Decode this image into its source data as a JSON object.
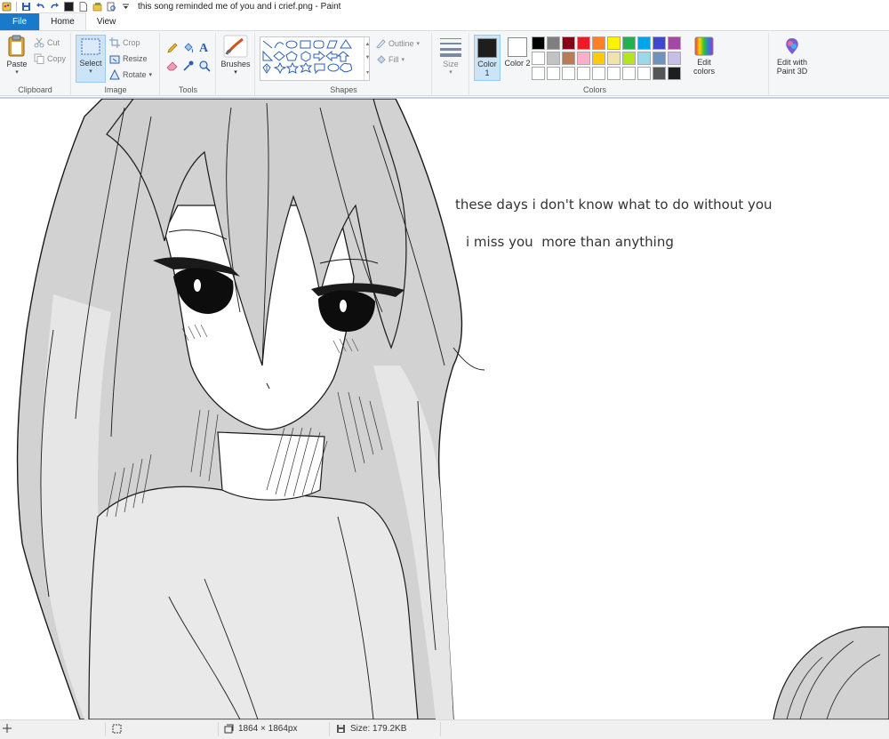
{
  "window": {
    "title": "this song reminded me of you and i crief.png - Paint"
  },
  "tabs": {
    "file": "File",
    "home": "Home",
    "view": "View"
  },
  "clipboard": {
    "paste": "Paste",
    "cut": "Cut",
    "copy": "Copy",
    "label": "Clipboard"
  },
  "image": {
    "select": "Select",
    "crop": "Crop",
    "resize": "Resize",
    "rotate": "Rotate",
    "label": "Image"
  },
  "tools": {
    "label": "Tools",
    "brushes": "Brushes"
  },
  "shapes": {
    "outline": "Outline",
    "fill": "Fill",
    "label": "Shapes"
  },
  "size": {
    "label": "Size"
  },
  "colors": {
    "color1": "Color 1",
    "color1_value": "#1e1e1e",
    "color2": "Color 2",
    "color2_value": "#ffffff",
    "edit_colors": "Edit colors",
    "edit_paint3d": "Edit with Paint 3D",
    "label": "Colors",
    "palette": [
      "#000000",
      "#7f7f7f",
      "#880015",
      "#ed1c24",
      "#ff7f27",
      "#fff200",
      "#22b14c",
      "#00a2e8",
      "#3f48cc",
      "#a349a4",
      "#ffffff",
      "#c3c3c3",
      "#b97a57",
      "#ffaec9",
      "#ffc90e",
      "#efe4b0",
      "#b5e61d",
      "#99d9ea",
      "#7092be",
      "#c8bfe7",
      "#ffffff",
      "#ffffff",
      "#ffffff",
      "#ffffff",
      "#ffffff",
      "#ffffff",
      "#ffffff",
      "#ffffff",
      "#555555",
      "#1e1e1e"
    ]
  },
  "canvas": {
    "text_line1": "these days i don't know what to do without you",
    "text_line2": "i miss you  more than anything"
  },
  "status": {
    "dimensions": "1864 × 1864px",
    "size": "Size: 179.2KB"
  }
}
